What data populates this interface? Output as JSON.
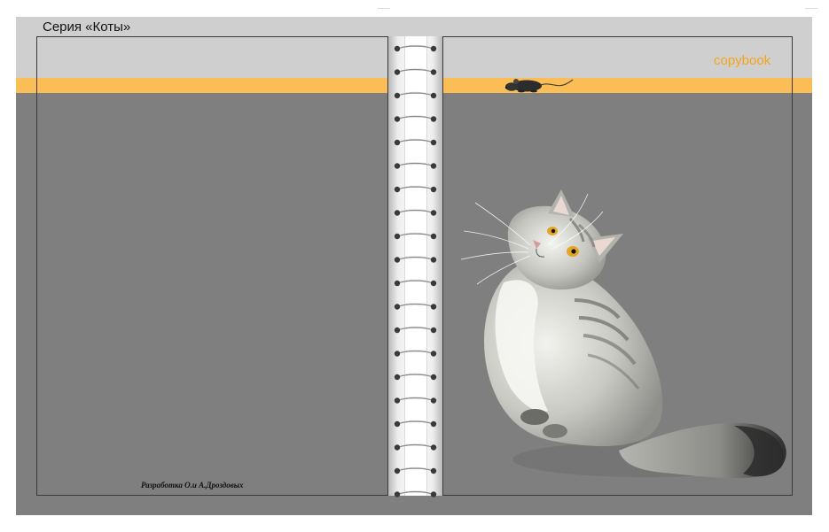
{
  "cover": {
    "series_title": "Серия «Коты»",
    "brand_label": "copybook",
    "credit": "Разработка О.и А.Дроздовых"
  },
  "colors": {
    "background": "#7f7f7f",
    "top_band": "#cfcfcf",
    "accent_stripe": "#fbbd55",
    "brand_text": "#f5a51c"
  },
  "illustrations": {
    "main": "fluffy-cat-icon",
    "detail": "mouse-icon",
    "binding": "spiral-binding-icon"
  }
}
